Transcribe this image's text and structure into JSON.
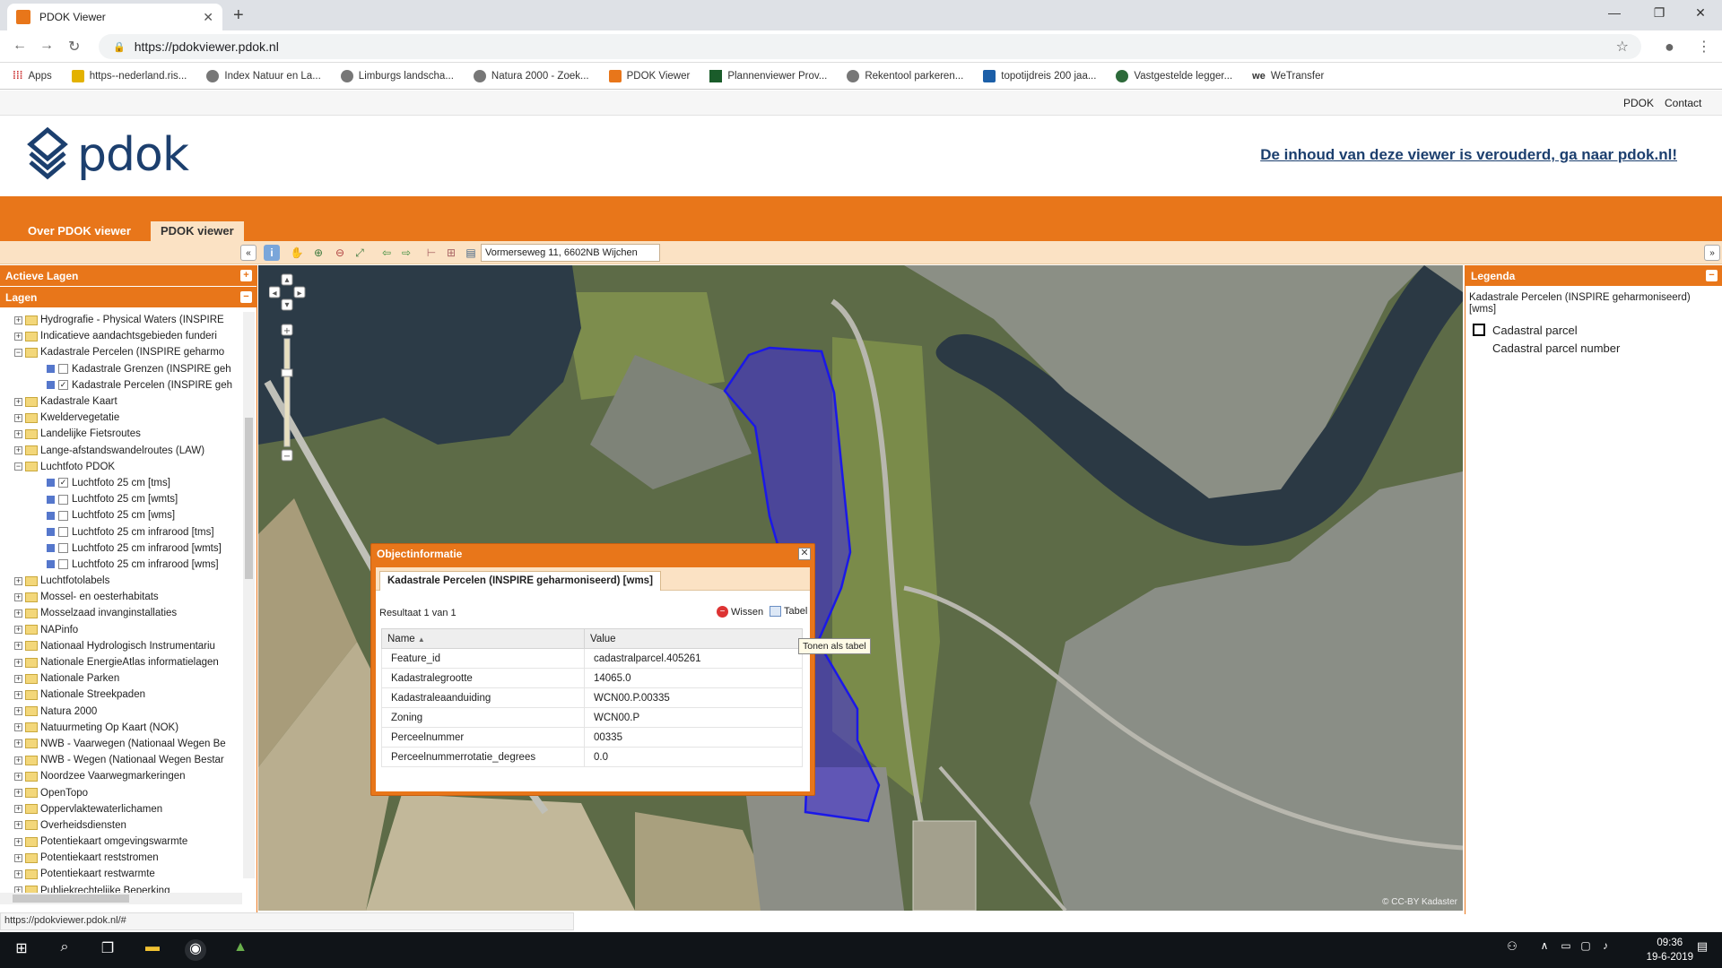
{
  "browser": {
    "tab_title": "PDOK Viewer",
    "url": "https://pdokviewer.pdok.nl",
    "bookmarks": [
      "Apps",
      "https--nederland.ris...",
      "Index Natuur en La...",
      "Limburgs landscha...",
      "Natura 2000 - Zoek...",
      "PDOK Viewer",
      "Plannenviewer Prov...",
      "Rekentool parkeren...",
      "topotijdreis 200 jaa...",
      "Vastgestelde legger...",
      "WeTransfer"
    ]
  },
  "site": {
    "topnav": [
      "PDOK",
      "Contact"
    ],
    "logo": "pdok",
    "notice": "De inhoud van deze viewer is verouderd, ga naar pdok.nl!",
    "tabs": [
      "Over PDOK viewer",
      "PDOK viewer"
    ]
  },
  "toolbar": {
    "search_value": "Vormerseweg 11, 6602NB Wijchen"
  },
  "left": {
    "active_layers": "Actieve Lagen",
    "layers": "Lagen",
    "tree": [
      {
        "t": "Hydrografie - Physical Waters (INSPIRE",
        "k": "f",
        "pm": "+"
      },
      {
        "t": "Indicatieve aandachtsgebieden funderi",
        "k": "f",
        "pm": "+"
      },
      {
        "t": "Kadastrale Percelen (INSPIRE geharmo",
        "k": "f",
        "pm": "−"
      },
      {
        "t": "Kadastrale Grenzen (INSPIRE geh",
        "k": "l",
        "c": false
      },
      {
        "t": "Kadastrale Percelen (INSPIRE geh",
        "k": "l",
        "c": true
      },
      {
        "t": "Kadastrale Kaart",
        "k": "f",
        "pm": "+"
      },
      {
        "t": "Kweldervegetatie",
        "k": "f",
        "pm": "+"
      },
      {
        "t": "Landelijke Fietsroutes",
        "k": "f",
        "pm": "+"
      },
      {
        "t": "Lange-afstandswandelroutes (LAW)",
        "k": "f",
        "pm": "+"
      },
      {
        "t": "Luchtfoto PDOK",
        "k": "f",
        "pm": "−"
      },
      {
        "t": "Luchtfoto 25 cm [tms]",
        "k": "l",
        "c": true
      },
      {
        "t": "Luchtfoto 25 cm [wmts]",
        "k": "l",
        "c": false
      },
      {
        "t": "Luchtfoto 25 cm [wms]",
        "k": "l",
        "c": false
      },
      {
        "t": "Luchtfoto 25 cm infrarood [tms]",
        "k": "l",
        "c": false
      },
      {
        "t": "Luchtfoto 25 cm infrarood [wmts]",
        "k": "l",
        "c": false
      },
      {
        "t": "Luchtfoto 25 cm infrarood [wms]",
        "k": "l",
        "c": false
      },
      {
        "t": "Luchtfotolabels",
        "k": "f",
        "pm": "+"
      },
      {
        "t": "Mossel- en oesterhabitats",
        "k": "f",
        "pm": "+"
      },
      {
        "t": "Mosselzaad invanginstallaties",
        "k": "f",
        "pm": "+"
      },
      {
        "t": "NAPinfo",
        "k": "f",
        "pm": "+"
      },
      {
        "t": "Nationaal Hydrologisch Instrumentariu",
        "k": "f",
        "pm": "+"
      },
      {
        "t": "Nationale EnergieAtlas informatielagen",
        "k": "f",
        "pm": "+"
      },
      {
        "t": "Nationale Parken",
        "k": "f",
        "pm": "+"
      },
      {
        "t": "Nationale Streekpaden",
        "k": "f",
        "pm": "+"
      },
      {
        "t": "Natura 2000",
        "k": "f",
        "pm": "+"
      },
      {
        "t": "Natuurmeting Op Kaart (NOK)",
        "k": "f",
        "pm": "+"
      },
      {
        "t": "NWB - Vaarwegen (Nationaal Wegen Be",
        "k": "f",
        "pm": "+"
      },
      {
        "t": "NWB - Wegen (Nationaal Wegen Bestar",
        "k": "f",
        "pm": "+"
      },
      {
        "t": "Noordzee Vaarwegmarkeringen",
        "k": "f",
        "pm": "+"
      },
      {
        "t": "OpenTopo",
        "k": "f",
        "pm": "+"
      },
      {
        "t": "Oppervlaktewaterlichamen",
        "k": "f",
        "pm": "+"
      },
      {
        "t": "Overheidsdiensten",
        "k": "f",
        "pm": "+"
      },
      {
        "t": "Potentiekaart omgevingswarmte",
        "k": "f",
        "pm": "+"
      },
      {
        "t": "Potentiekaart reststromen",
        "k": "f",
        "pm": "+"
      },
      {
        "t": "Potentiekaart restwarmte",
        "k": "f",
        "pm": "+"
      },
      {
        "t": "Publiekrechtelijke Beperking",
        "k": "f",
        "pm": "+"
      }
    ]
  },
  "legend": {
    "title": "Legenda",
    "layer": "Kadastrale Percelen (INSPIRE geharmoniseerd) [wms]",
    "item1": "Cadastral parcel",
    "item2": "Cadastral parcel number"
  },
  "popup": {
    "title": "Objectinformatie",
    "tab": "Kadastrale Percelen (INSPIRE geharmoniseerd) [wms]",
    "result": "Resultaat 1 van 1",
    "clear": "Wissen",
    "table": "Tabel",
    "tooltip": "Tonen als tabel",
    "col_name": "Name",
    "col_value": "Value",
    "rows": [
      [
        "Feature_id",
        "cadastralparcel.405261"
      ],
      [
        "Kadastralegrootte",
        "14065.0"
      ],
      [
        "Kadastraleaanduiding",
        "WCN00.P.00335"
      ],
      [
        "Zoning",
        "WCN00.P"
      ],
      [
        "Perceelnummer",
        "00335"
      ],
      [
        "Perceelnummerrotatie_degrees",
        "0.0"
      ]
    ]
  },
  "map": {
    "attribution": "© CC-BY Kadaster"
  },
  "status": {
    "url": "https://pdokviewer.pdok.nl/#"
  },
  "clock": {
    "time": "09:36",
    "date": "19-6-2019"
  }
}
